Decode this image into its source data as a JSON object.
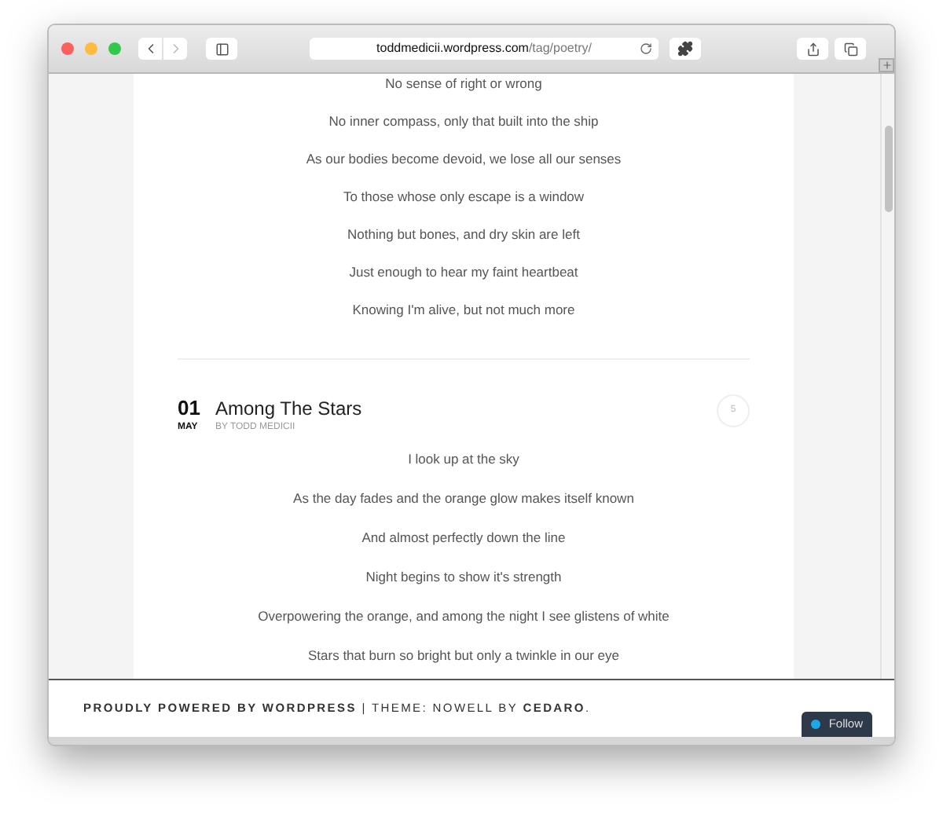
{
  "browser": {
    "url_host": "toddmedicii.wordpress.com",
    "url_path": "/tag/poetry/"
  },
  "previous_post": {
    "lines": [
      "No sense of right or wrong",
      "No inner compass, only that built into the ship",
      "As our bodies become devoid, we lose all our senses",
      "To those whose only escape is a window",
      "Nothing but bones, and dry skin are left",
      "Just enough to hear my faint heartbeat",
      "Knowing I'm alive, but not much more"
    ]
  },
  "post": {
    "day": "01",
    "month": "MAY",
    "title": "Among The Stars",
    "byline": "BY TODD MEDICII",
    "comment_count": "5",
    "lines": [
      "I look up at the sky",
      "As the day fades and the orange glow makes itself known",
      "And almost perfectly down the line",
      "Night begins to show it's strength",
      "Overpowering the orange, and among the night I see glistens of white",
      "Stars that burn so bright but only a twinkle in our eye"
    ]
  },
  "footer": {
    "credit": "**PROUDLY POWERED BY WORDPRESS** | THEME: NOWELL BY **CEDARO**."
  },
  "follow_button": "Follow"
}
